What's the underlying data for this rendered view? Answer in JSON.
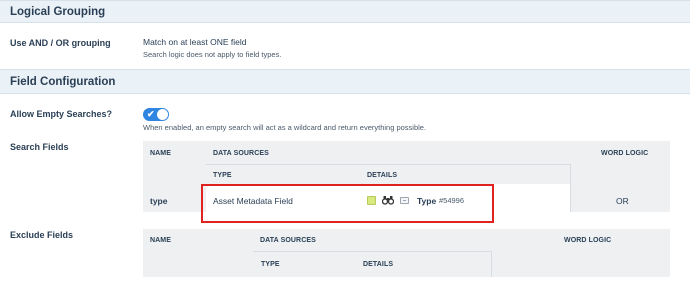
{
  "logical_grouping": {
    "title": "Logical Grouping",
    "label": "Use AND / OR grouping",
    "value": "Match on at least ONE field",
    "hint": "Search logic does not apply to field types."
  },
  "field_configuration": {
    "title": "Field Configuration",
    "allow_empty": {
      "label": "Allow Empty Searches?",
      "enabled": true,
      "toggle_glyph": "✔",
      "hint": "When enabled, an empty search will act as a wildcard and return everything possible."
    }
  },
  "search_fields": {
    "label": "Search Fields",
    "headers": {
      "name": "NAME",
      "data_sources": "DATA SOURCES",
      "type": "TYPE",
      "details": "DETAILS",
      "word_logic": "WORD LOGIC"
    },
    "rows": [
      {
        "name": "type",
        "type": "Asset Metadata Field",
        "details_icons": [
          "color-swatch-icon",
          "binoculars-icon",
          "field-icon"
        ],
        "details_label": "Type",
        "details_id": "#54996",
        "word_logic": "OR"
      }
    ]
  },
  "exclude_fields": {
    "label": "Exclude Fields",
    "headers": {
      "name": "NAME",
      "data_sources": "DATA SOURCES",
      "type": "TYPE",
      "details": "DETAILS",
      "word_logic": "WORD LOGIC"
    }
  },
  "colors": {
    "section_bg": "#eaf1f7",
    "toggle": "#2f86e0",
    "highlight": "#e0231f",
    "swatch": "#d8ea7e"
  }
}
